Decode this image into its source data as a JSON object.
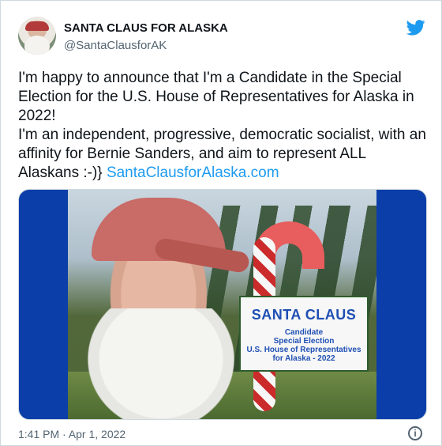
{
  "author": {
    "name": "SANTA CLAUS FOR ALASKA",
    "handle": "@SantaClausforAK"
  },
  "tweet": {
    "line1": "I'm happy to announce that I'm a Candidate in the Special Election for the U.S. House of Representatives for Alaska in 2022!",
    "line2_prefix": "I'm an independent, progressive, democratic socialist, with an affinity for Bernie Sanders, and aim to represent ALL Alaskans :-)} ",
    "link": "SantaClausforAlaska.com"
  },
  "media": {
    "sign_title": "SANTA CLAUS",
    "sign_line1": "Candidate",
    "sign_line2": "Special Election",
    "sign_line3": "U.S. House of Representatives",
    "sign_line4": "for Alaska - 2022"
  },
  "meta": {
    "timestamp": "1:41 PM · Apr 1, 2022",
    "info_icon_label": "i"
  },
  "icons": {
    "brand": "twitter-icon",
    "info": "info-icon"
  },
  "colors": {
    "link": "#1d9bf0",
    "twitter_blue": "#1d9bf0",
    "media_bg": "#0b3ea9"
  }
}
